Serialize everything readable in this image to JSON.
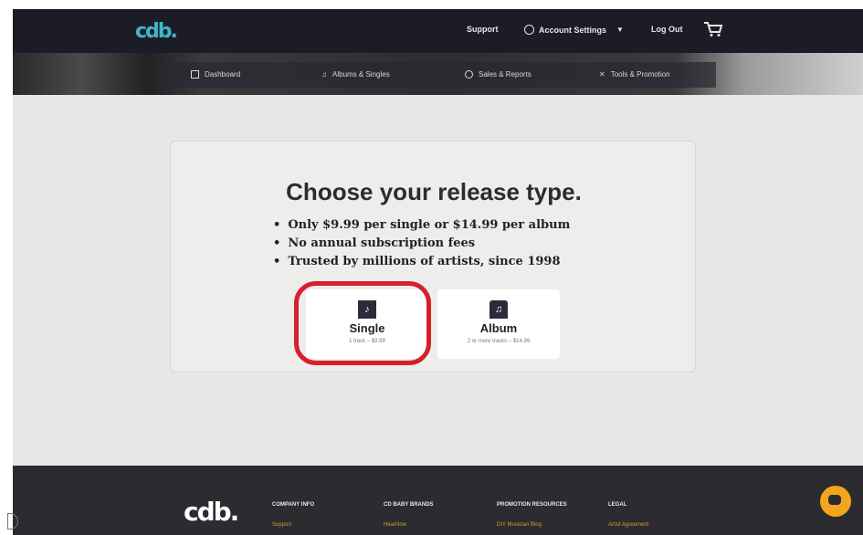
{
  "header": {
    "logo": "cdb.",
    "support": "Support",
    "account_settings": "Account Settings",
    "logout": "Log Out"
  },
  "nav": {
    "dashboard": "Dashboard",
    "albums": "Albums & Singles",
    "sales": "Sales & Reports",
    "tools": "Tools & Promotion"
  },
  "main": {
    "title": "Choose your release type.",
    "bullets": [
      "Only $9.99 per single or $14.99 per album",
      "No annual subscription fees",
      "Trusted by millions of artists, since 1998"
    ],
    "single": {
      "label": "Single",
      "sub": "1 track – $9.99"
    },
    "album": {
      "label": "Album",
      "sub": "2 or more tracks – $14.99"
    }
  },
  "footer": {
    "logo": "cdb.",
    "columns": [
      {
        "head": "COMPANY INFO",
        "link": "Support"
      },
      {
        "head": "CD BABY BRANDS",
        "link": "HearNow"
      },
      {
        "head": "PROMOTION RESOURCES",
        "link": "DIY Musician Blog"
      },
      {
        "head": "LEGAL",
        "link": "Artist Agreement"
      }
    ]
  },
  "colors": {
    "highlight": "#d7202c",
    "accent": "#3fb6c7",
    "chat": "#f3a51c"
  }
}
